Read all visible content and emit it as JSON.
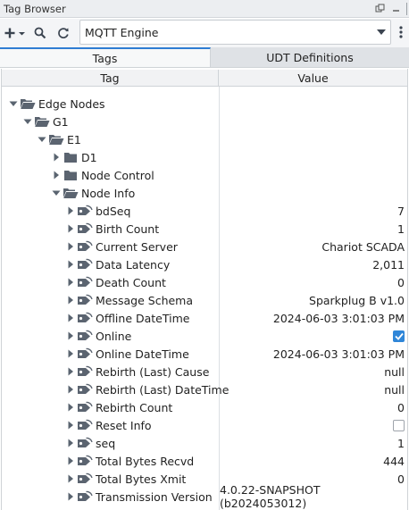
{
  "window": {
    "title": "Tag Browser"
  },
  "toolbar": {
    "provider": "MQTT Engine"
  },
  "tabs": [
    {
      "label": "Tags"
    },
    {
      "label": "UDT Definitions"
    }
  ],
  "columns": {
    "tag": "Tag",
    "value": "Value"
  },
  "tree": [
    {
      "label": "Edge Nodes",
      "indent": 0,
      "expanded": true,
      "kind": "folder-open",
      "value": ""
    },
    {
      "label": "G1",
      "indent": 1,
      "expanded": true,
      "kind": "folder-open",
      "value": ""
    },
    {
      "label": "E1",
      "indent": 2,
      "expanded": true,
      "kind": "folder-open",
      "value": ""
    },
    {
      "label": "D1",
      "indent": 3,
      "expanded": false,
      "kind": "folder",
      "value": ""
    },
    {
      "label": "Node Control",
      "indent": 3,
      "expanded": false,
      "kind": "folder",
      "value": ""
    },
    {
      "label": "Node Info",
      "indent": 3,
      "expanded": true,
      "kind": "folder-open",
      "value": ""
    },
    {
      "label": "bdSeq",
      "indent": 4,
      "expanded": false,
      "kind": "tag",
      "value": "7"
    },
    {
      "label": "Birth Count",
      "indent": 4,
      "expanded": false,
      "kind": "tag",
      "value": "1"
    },
    {
      "label": "Current Server",
      "indent": 4,
      "expanded": false,
      "kind": "tag",
      "value": "Chariot SCADA"
    },
    {
      "label": "Data Latency",
      "indent": 4,
      "expanded": false,
      "kind": "tag",
      "value": "2,011"
    },
    {
      "label": "Death Count",
      "indent": 4,
      "expanded": false,
      "kind": "tag",
      "value": "0"
    },
    {
      "label": "Message Schema",
      "indent": 4,
      "expanded": false,
      "kind": "tag",
      "value": "Sparkplug B v1.0"
    },
    {
      "label": "Offline DateTime",
      "indent": 4,
      "expanded": false,
      "kind": "tag",
      "value": "2024-06-03 3:01:03 PM"
    },
    {
      "label": "Online",
      "indent": 4,
      "expanded": false,
      "kind": "tag",
      "value": "",
      "checkbox": true
    },
    {
      "label": "Online DateTime",
      "indent": 4,
      "expanded": false,
      "kind": "tag",
      "value": "2024-06-03 3:01:03 PM"
    },
    {
      "label": "Rebirth (Last) Cause",
      "indent": 4,
      "expanded": false,
      "kind": "tag",
      "value": "null"
    },
    {
      "label": "Rebirth (Last) DateTime",
      "indent": 4,
      "expanded": false,
      "kind": "tag",
      "value": "null"
    },
    {
      "label": "Rebirth Count",
      "indent": 4,
      "expanded": false,
      "kind": "tag",
      "value": "0"
    },
    {
      "label": "Reset Info",
      "indent": 4,
      "expanded": false,
      "kind": "tag",
      "value": "",
      "checkbox": false
    },
    {
      "label": "seq",
      "indent": 4,
      "expanded": false,
      "kind": "tag",
      "value": "1"
    },
    {
      "label": "Total Bytes Recvd",
      "indent": 4,
      "expanded": false,
      "kind": "tag",
      "value": "444"
    },
    {
      "label": "Total Bytes Xmit",
      "indent": 4,
      "expanded": false,
      "kind": "tag",
      "value": "0"
    },
    {
      "label": "Transmission Version",
      "indent": 4,
      "expanded": false,
      "kind": "tag",
      "value": "4.0.22-SNAPSHOT (b2024053012)"
    }
  ]
}
